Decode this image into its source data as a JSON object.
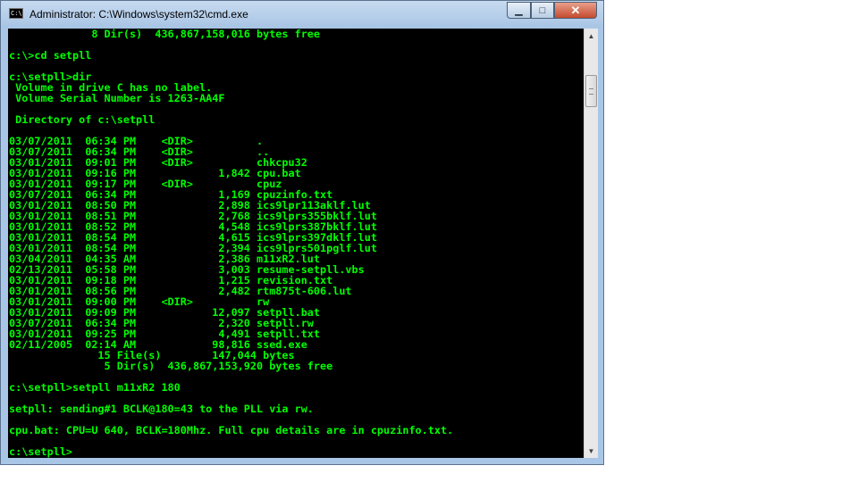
{
  "window": {
    "title": "Administrator: C:\\Windows\\system32\\cmd.exe",
    "icon": "cmd-icon",
    "icon_text": "C:\\",
    "controls": {
      "minimize": "▁",
      "maximize": "□",
      "close": "✕"
    }
  },
  "console": {
    "background": "#000000",
    "foreground": "#00ff00",
    "lines": [
      "             8 Dir(s)  436,867,158,016 bytes free",
      "",
      "c:\\>cd setpll",
      "",
      "c:\\setpll>dir",
      " Volume in drive C has no label.",
      " Volume Serial Number is 1263-AA4F",
      "",
      " Directory of c:\\setpll",
      "",
      "03/07/2011  06:34 PM    <DIR>          .",
      "03/07/2011  06:34 PM    <DIR>          ..",
      "03/01/2011  09:01 PM    <DIR>          chkcpu32",
      "03/01/2011  09:16 PM             1,842 cpu.bat",
      "03/01/2011  09:17 PM    <DIR>          cpuz",
      "03/07/2011  06:34 PM             1,169 cpuzinfo.txt",
      "03/01/2011  08:50 PM             2,898 ics9lpr113aklf.lut",
      "03/01/2011  08:51 PM             2,768 ics9lprs355bklf.lut",
      "03/01/2011  08:52 PM             4,548 ics9lprs387bklf.lut",
      "03/01/2011  08:54 PM             4,615 ics9lprs397dklf.lut",
      "03/01/2011  08:54 PM             2,394 ics9lprs501pglf.lut",
      "03/04/2011  04:35 AM             2,386 m11xR2.lut",
      "02/13/2011  05:58 PM             3,003 resume-setpll.vbs",
      "03/01/2011  09:18 PM             1,215 revision.txt",
      "03/01/2011  08:56 PM             2,482 rtm875t-606.lut",
      "03/01/2011  09:00 PM    <DIR>          rw",
      "03/01/2011  09:09 PM            12,097 setpll.bat",
      "03/07/2011  06:34 PM             2,320 setpll.rw",
      "03/01/2011  09:25 PM             4,491 setpll.txt",
      "02/11/2005  02:14 AM            98,816 ssed.exe",
      "              15 File(s)        147,044 bytes",
      "               5 Dir(s)  436,867,153,920 bytes free",
      "",
      "c:\\setpll>setpll m11xR2 180",
      "",
      "setpll: sending#1 BCLK@180=43 to the PLL via rw.",
      "",
      "cpu.bat: CPU=U 640, BCLK=180Mhz. Full cpu details are in cpuzinfo.txt.",
      "",
      "c:\\setpll>"
    ]
  },
  "scrollbar": {
    "up": "▲",
    "down": "▼"
  }
}
